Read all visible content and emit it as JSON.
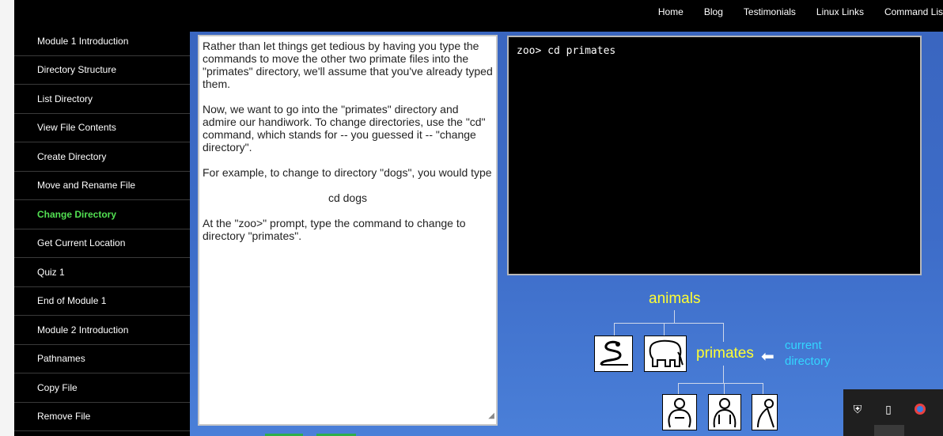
{
  "topnav": [
    "Home",
    "Blog",
    "Testimonials",
    "Linux Links",
    "Command Lis"
  ],
  "sidebar": {
    "items": [
      {
        "label": "Module 1 Introduction",
        "active": false
      },
      {
        "label": "Directory Structure",
        "active": false
      },
      {
        "label": "List Directory",
        "active": false
      },
      {
        "label": "View File Contents",
        "active": false
      },
      {
        "label": "Create Directory",
        "active": false
      },
      {
        "label": "Move and Rename File",
        "active": false
      },
      {
        "label": "Change Directory",
        "active": true
      },
      {
        "label": "Get Current Location",
        "active": false
      },
      {
        "label": "Quiz 1",
        "active": false
      },
      {
        "label": "End of Module 1",
        "active": false
      },
      {
        "label": "Module 2 Introduction",
        "active": false
      },
      {
        "label": "Pathnames",
        "active": false
      },
      {
        "label": "Copy File",
        "active": false
      },
      {
        "label": "Remove File",
        "active": false
      }
    ]
  },
  "lesson": {
    "p1": "Rather than let things get tedious by having you type the commands to move the other two primate files into the \"primates\" directory, we'll assume that you've already typed them.",
    "p2": "Now, we want to go into the \"primates\" directory and admire our handiwork. To change directories, use the \"cd\" command, which stands for -- you guessed it -- \"change directory\".",
    "p3": "For example, to change to directory \"dogs\", you would type",
    "code": "cd dogs",
    "p4": "At the \"zoo>\" prompt, type the command to change to directory \"primates\"."
  },
  "terminal": {
    "line": "zoo> cd primates"
  },
  "tree": {
    "root": "animals",
    "current": "primates",
    "current_label_1": "current",
    "current_label_2": "directory",
    "children_top": [
      "snake-icon",
      "elephant-icon"
    ],
    "children_bottom": [
      "gorilla-icon",
      "gorilla-2-icon",
      "monkey-icon"
    ]
  },
  "colors": {
    "active_nav": "#52e052",
    "tree_label": "#ffff33",
    "current_dir": "#33d6ff"
  }
}
